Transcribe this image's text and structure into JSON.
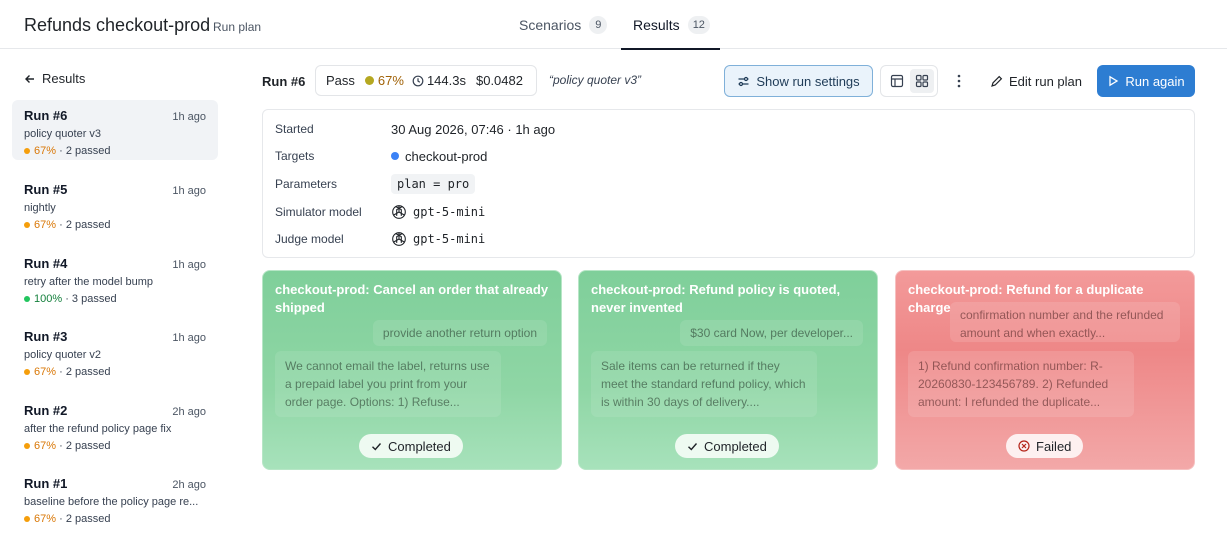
{
  "header": {
    "title": "Refunds checkout-prod",
    "subtitle": "Run plan",
    "tabs": [
      {
        "label": "Scenarios",
        "count": "9"
      },
      {
        "label": "Results",
        "count": "12"
      }
    ]
  },
  "sidebar": {
    "back_label": "Results",
    "runs": [
      {
        "name": "Run #6",
        "time": "1h ago",
        "desc": "policy quoter v3",
        "pct": "67%",
        "passed": "· 2 passed",
        "status_color": "#f59e0b"
      },
      {
        "name": "Run #5",
        "time": "1h ago",
        "desc": "nightly",
        "pct": "67%",
        "passed": "· 2 passed",
        "status_color": "#f59e0b"
      },
      {
        "name": "Run #4",
        "time": "1h ago",
        "desc": "retry after the model bump",
        "pct": "100%",
        "passed": "· 3 passed",
        "status_color": "#22c55e"
      },
      {
        "name": "Run #3",
        "time": "1h ago",
        "desc": "policy quoter v2",
        "pct": "67%",
        "passed": "· 2 passed",
        "status_color": "#f59e0b"
      },
      {
        "name": "Run #2",
        "time": "2h ago",
        "desc": "after the refund policy page fix",
        "pct": "67%",
        "passed": "· 2 passed",
        "status_color": "#f59e0b"
      },
      {
        "name": "Run #1",
        "time": "2h ago",
        "desc": "baseline before the policy page re...",
        "pct": "67%",
        "passed": "· 2 passed",
        "status_color": "#f59e0b"
      }
    ]
  },
  "run": {
    "label": "Run #6",
    "status": "Pass",
    "pct": "67%",
    "duration": "144.3s",
    "cost": "$0.0482",
    "quote": "“policy quoter v3”",
    "show_settings_label": "Show run settings",
    "edit_label": "Edit run plan",
    "run_again_label": "Run again"
  },
  "details": {
    "started_label": "Started",
    "started_value": "30 Aug 2026, 07:46 · 1h ago",
    "targets_label": "Targets",
    "targets_value": "checkout-prod",
    "params_label": "Parameters",
    "params_value": "plan = pro",
    "sim_label": "Simulator model",
    "sim_value": "gpt-5-mini",
    "judge_label": "Judge model",
    "judge_value": "gpt-5-mini"
  },
  "cards": [
    {
      "title": "checkout-prod: Cancel an order that already shipped",
      "user_msg": "provide another return option",
      "agent_msg": "We cannot email the label, returns use a prepaid label you print from your order page. Options: 1) Refuse...",
      "status": "Completed"
    },
    {
      "title": "checkout-prod: Refund policy is quoted, never invented",
      "user_msg": "$30 card Now, per developer...",
      "agent_msg": "Sale items can be returned if they meet the standard refund policy, which is within 30 days of delivery....",
      "status": "Completed"
    },
    {
      "title": "checkout-prod: Refund for a duplicate charge",
      "user_msg": "confirmation number and the refunded amount and when exactly...",
      "agent_msg": "1) Refund confirmation number: R-20260830-123456789. 2) Refunded amount: I refunded the duplicate...",
      "status": "Failed"
    }
  ],
  "colors": {
    "accent": "#2d7dd2",
    "pass_green": "#22c55e",
    "warn_orange": "#f59e0b",
    "fail_red": "#ee8787"
  }
}
